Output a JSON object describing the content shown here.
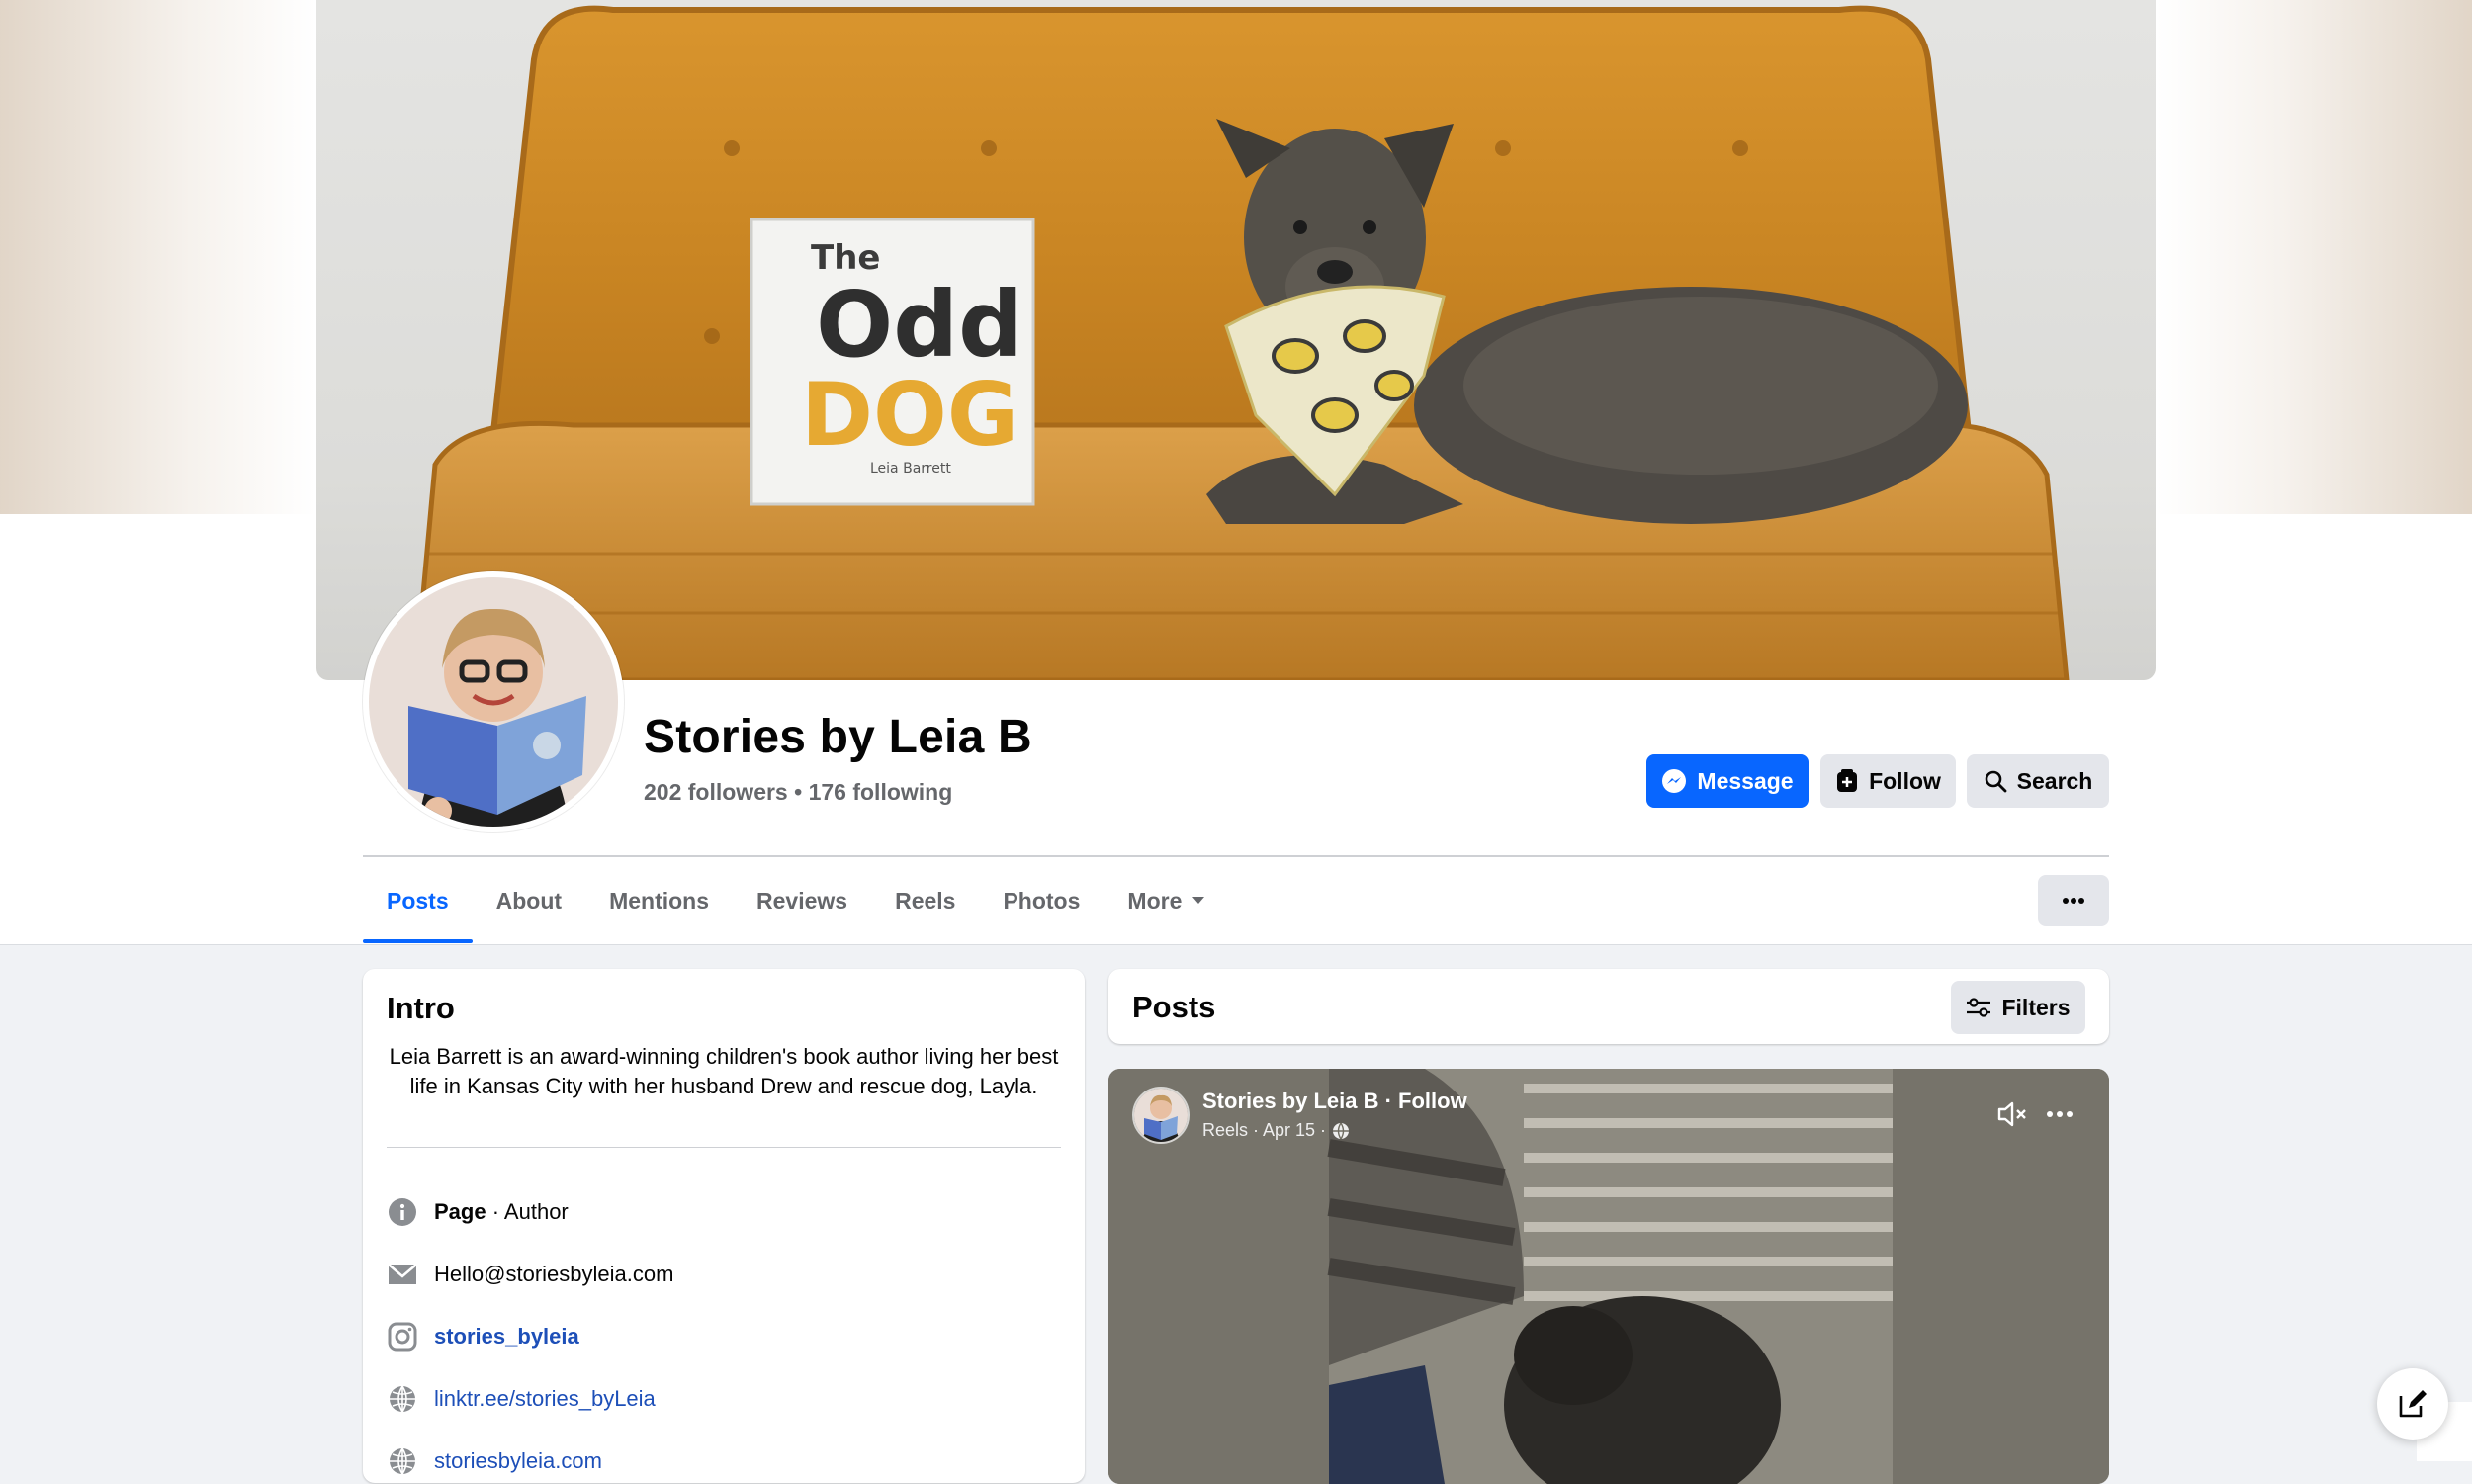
{
  "page": {
    "name": "Stories by Leia B",
    "followers": "202 followers",
    "separator": "•",
    "following": "176 following"
  },
  "actions": {
    "message_label": "Message",
    "follow_label": "Follow",
    "search_label": "Search"
  },
  "tabs": [
    {
      "label": "Posts",
      "active": true
    },
    {
      "label": "About"
    },
    {
      "label": "Mentions"
    },
    {
      "label": "Reviews"
    },
    {
      "label": "Reels"
    },
    {
      "label": "Photos"
    },
    {
      "label": "More"
    }
  ],
  "cover": {
    "book_title_top": "The",
    "book_title_main": "Odd",
    "book_title_bottom": "DOG",
    "book_author": "Leia Barrett"
  },
  "intro": {
    "title": "Intro",
    "bio": "Leia Barrett is an award-winning children's book author living her best life in Kansas City with her husband Drew and rescue dog, Layla.",
    "category_label": "Page",
    "category_value": " · Author",
    "email": "Hello@storiesbyleia.com",
    "instagram": "stories_byleia",
    "link1": "linktr.ee/stories_byLeia",
    "link2": "storiesbyleia.com"
  },
  "posts": {
    "title": "Posts",
    "filters_label": "Filters"
  },
  "reel": {
    "author_line": "Stories by Leia B · Follow",
    "meta": "Reels · Apr 15 ·"
  },
  "colors": {
    "primary": "#0866ff",
    "link": "#1d4fb8",
    "secondary_text": "#65676b",
    "button_gray": "#e4e6eb"
  }
}
